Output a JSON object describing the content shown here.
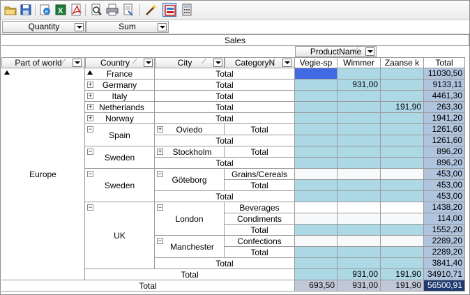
{
  "toolbar": {
    "icons": [
      "open-folder-icon",
      "save-icon",
      "ie-export-icon",
      "excel-export-icon",
      "pdf-export-icon",
      "print-preview-icon",
      "print-icon",
      "page-setup-icon",
      "wand-icon",
      "olap-icon",
      "calculator-icon"
    ]
  },
  "filters": {
    "quantity": "Quantity",
    "sum": "Sum"
  },
  "header": {
    "sales": "Sales",
    "product_name": "ProductName",
    "part_of_world": "Part of world",
    "country": "Country",
    "city": "City",
    "category": "CategoryN",
    "columns": [
      "Vegie-sp",
      "Wimmer",
      "Zaanse k",
      "Total"
    ]
  },
  "rows": {
    "europe": "Europe",
    "france": "France",
    "germany": "Germany",
    "italy": "Italy",
    "netherlands": "Netherlands",
    "norway": "Norway",
    "spain": "Spain",
    "oviedo": "Oviedo",
    "sweden1": "Sweden",
    "stockholm": "Stockholm",
    "sweden2": "Sweden",
    "goteborg": "Göteborg",
    "grains": "Grains/Cereals",
    "uk": "UK",
    "london": "London",
    "beverages": "Beverages",
    "condiments": "Condiments",
    "manchester": "Manchester",
    "confections": "Confections",
    "total": "Total"
  },
  "values": {
    "france_total": "11030,50",
    "germany_wimmer": "931,00",
    "germany_total": "9133,11",
    "italy_total": "4461,30",
    "netherlands_zaanse": "191,90",
    "netherlands_total": "263,30",
    "norway_total": "1941,20",
    "oviedo_total": "1261,60",
    "spain_total": "1261,60",
    "stockholm_total": "896,20",
    "sweden1_total": "896,20",
    "grains_total": "453,00",
    "goteborg_total": "453,00",
    "sweden2_total": "453,00",
    "beverages_total": "1438,20",
    "condiments_total": "114,00",
    "london_total": "1552,20",
    "confections_total": "2289,20",
    "manchester_total": "2289,20",
    "uk_total": "3841,40",
    "europe_wimmer": "931,00",
    "europe_zaanse": "191,90",
    "europe_total": "34910,71",
    "grand_vegie": "693,50",
    "grand_wimmer": "931,00",
    "grand_zaanse": "191,90",
    "grand_total": "56500,91"
  },
  "colors": {
    "cell_fill": "#add8e6",
    "total_fill": "#b0c4de",
    "selected": "#4169e1",
    "grand_total": "#1e3a6e"
  }
}
